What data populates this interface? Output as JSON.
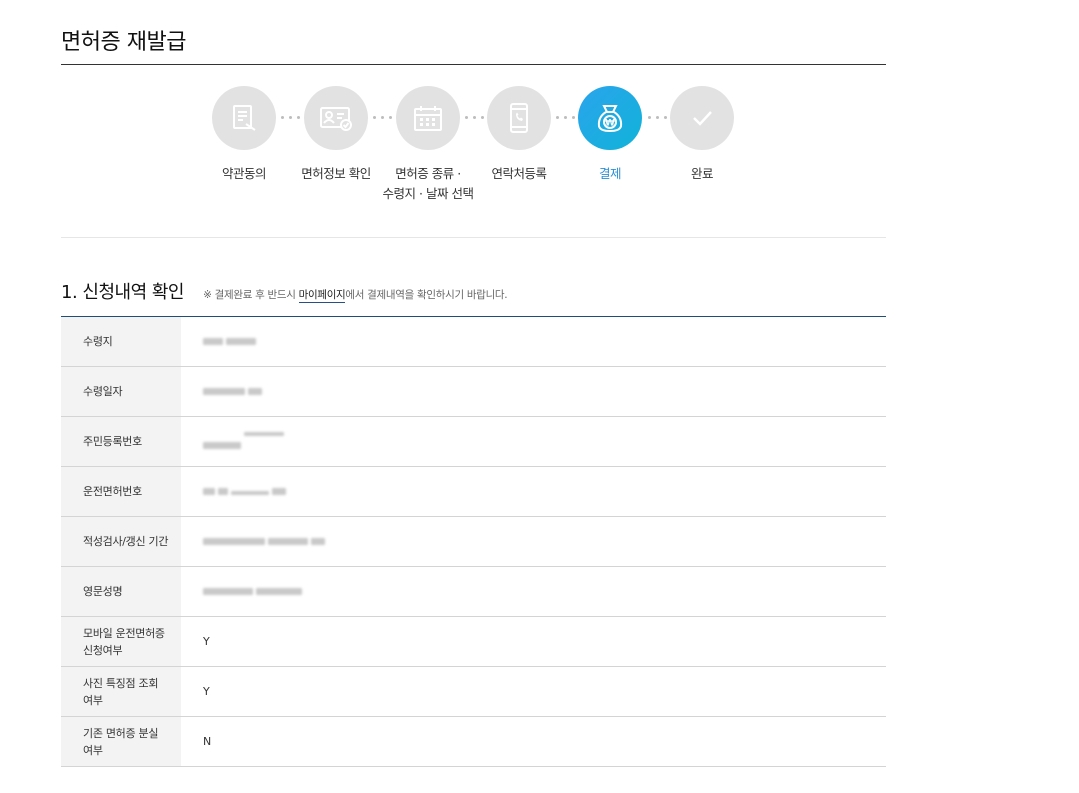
{
  "page": {
    "title": "면허증 재발급"
  },
  "steps": [
    {
      "label": "약관동의",
      "icon": "document-icon",
      "active": false
    },
    {
      "label": "면허정보 확인",
      "icon": "id-card-check-icon",
      "active": false
    },
    {
      "label_line1": "면허증 종류 ·",
      "label_line2": "수령지 · 날짜 선택",
      "icon": "calendar-icon",
      "active": false
    },
    {
      "label": "연락처등록",
      "icon": "phone-icon",
      "active": false
    },
    {
      "label": "결제",
      "icon": "money-bag-won-icon",
      "active": true
    },
    {
      "label": "완료",
      "icon": "check-icon",
      "active": false
    }
  ],
  "section": {
    "title": "1. 신청내역 확인",
    "note_prefix": "※ 결제완료 후 반드시 ",
    "note_link": "마이페이지",
    "note_suffix": "에서 결제내역을 확인하시기 바랍니다."
  },
  "rows": [
    {
      "label": "수령지",
      "value": ""
    },
    {
      "label": "수령일자",
      "value": ""
    },
    {
      "label": "주민등록번호",
      "value": ""
    },
    {
      "label": "운전면허번호",
      "value": ""
    },
    {
      "label": "적성검사/갱신 기간",
      "value": ""
    },
    {
      "label": "영문성명",
      "value": ""
    },
    {
      "label_line1": "모바일 운전면허증",
      "label_line2": "신청여부",
      "value": "Y"
    },
    {
      "label_line1": "사진 특징점 조회",
      "label_line2": "여부",
      "value": "Y"
    },
    {
      "label_line1": "기존 면허증 분실",
      "label_line2": "여부",
      "value": "N"
    }
  ],
  "colors": {
    "accent": "#1aa8e6",
    "header_rule": "#1f4e79",
    "label_bg": "#f3f3f3"
  }
}
